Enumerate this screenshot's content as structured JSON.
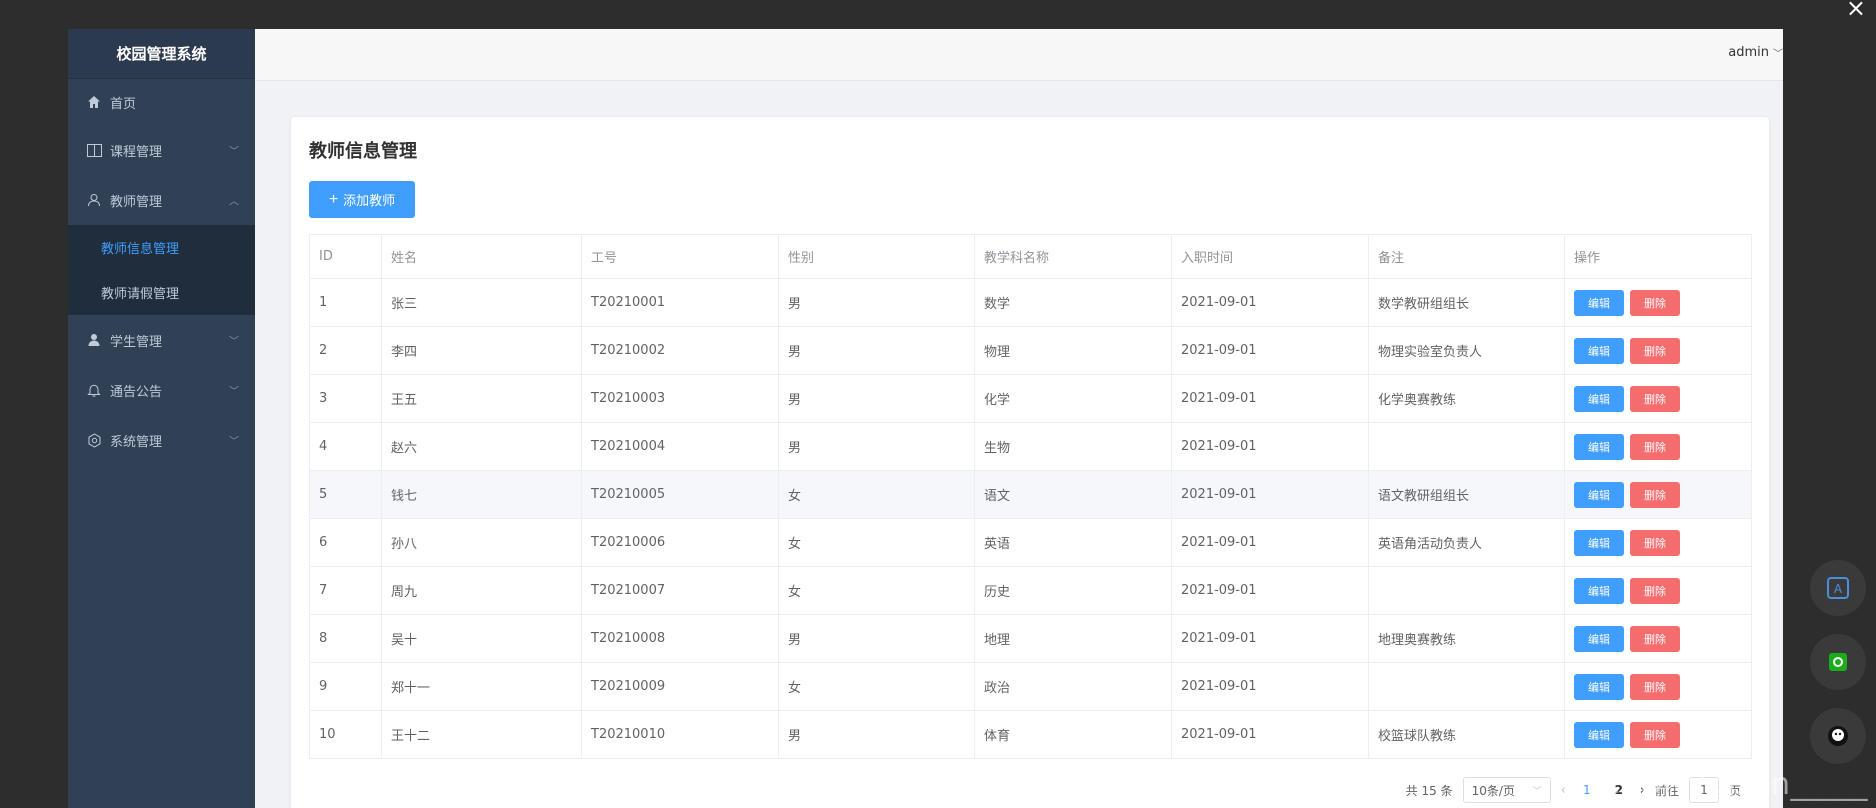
{
  "app": {
    "title": "校园管理系统",
    "user": "admin"
  },
  "sidebar": {
    "items": [
      {
        "label": "首页",
        "icon": "home-icon"
      },
      {
        "label": "课程管理",
        "icon": "book-icon",
        "expanded": false
      },
      {
        "label": "教师管理",
        "icon": "user-outline-icon",
        "expanded": true,
        "children": [
          {
            "label": "教师信息管理",
            "active": true
          },
          {
            "label": "教师请假管理",
            "active": false
          }
        ]
      },
      {
        "label": "学生管理",
        "icon": "user-filled-icon",
        "expanded": false
      },
      {
        "label": "通告公告",
        "icon": "bell-icon",
        "expanded": false
      },
      {
        "label": "系统管理",
        "icon": "settings-icon",
        "expanded": false
      }
    ]
  },
  "page": {
    "title": "教师信息管理",
    "add_button": "添加教师"
  },
  "table": {
    "columns": [
      "ID",
      "姓名",
      "工号",
      "性别",
      "教学科名称",
      "入职时间",
      "备注",
      "操作"
    ],
    "edit_label": "编辑",
    "delete_label": "删除",
    "rows": [
      {
        "id": "1",
        "name": "张三",
        "no": "T20210001",
        "gender": "男",
        "subject": "数学",
        "date": "2021-09-01",
        "note": "数学教研组组长"
      },
      {
        "id": "2",
        "name": "李四",
        "no": "T20210002",
        "gender": "男",
        "subject": "物理",
        "date": "2021-09-01",
        "note": "物理实验室负责人"
      },
      {
        "id": "3",
        "name": "王五",
        "no": "T20210003",
        "gender": "男",
        "subject": "化学",
        "date": "2021-09-01",
        "note": "化学奥赛教练"
      },
      {
        "id": "4",
        "name": "赵六",
        "no": "T20210004",
        "gender": "男",
        "subject": "生物",
        "date": "2021-09-01",
        "note": ""
      },
      {
        "id": "5",
        "name": "钱七",
        "no": "T20210005",
        "gender": "女",
        "subject": "语文",
        "date": "2021-09-01",
        "note": "语文教研组组长"
      },
      {
        "id": "6",
        "name": "孙八",
        "no": "T20210006",
        "gender": "女",
        "subject": "英语",
        "date": "2021-09-01",
        "note": "英语角活动负责人"
      },
      {
        "id": "7",
        "name": "周九",
        "no": "T20210007",
        "gender": "女",
        "subject": "历史",
        "date": "2021-09-01",
        "note": ""
      },
      {
        "id": "8",
        "name": "吴十",
        "no": "T20210008",
        "gender": "男",
        "subject": "地理",
        "date": "2021-09-01",
        "note": "地理奥赛教练"
      },
      {
        "id": "9",
        "name": "郑十一",
        "no": "T20210009",
        "gender": "女",
        "subject": "政治",
        "date": "2021-09-01",
        "note": ""
      },
      {
        "id": "10",
        "name": "王十二",
        "no": "T20210010",
        "gender": "男",
        "subject": "体育",
        "date": "2021-09-01",
        "note": "校篮球队教练"
      }
    ],
    "highlighted_row": 4
  },
  "pagination": {
    "total": "共 15 条",
    "page_size": "10条/页",
    "pages": [
      "1",
      "2"
    ],
    "current": "1",
    "goto_label": "前往",
    "goto_value": "1",
    "page_suffix": "页"
  },
  "overlay": {
    "close_symbol": "×",
    "watermark": "CSDN @Json_____"
  },
  "colors": {
    "primary": "#409eff",
    "danger": "#f56c6c",
    "sidebar_bg": "#304156",
    "sidebar_text": "#bfcbd9"
  }
}
